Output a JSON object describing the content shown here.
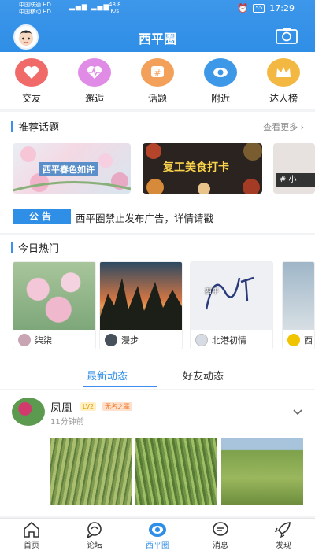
{
  "status": {
    "carrier1": "中国联通",
    "carrier2": "中国移动",
    "hd": "HD",
    "net_speed": "48.8",
    "net_unit": "K/s",
    "battery": "55",
    "time": "17:29"
  },
  "header": {
    "title": "西平圈"
  },
  "quick_icons": [
    {
      "label": "交友",
      "icon": "heart-icon",
      "color": "#f06a6a"
    },
    {
      "label": "邂逅",
      "icon": "heartbeat-icon",
      "color": "#e08be6"
    },
    {
      "label": "话题",
      "icon": "hashtag-icon",
      "color": "#f3a05a"
    },
    {
      "label": "附近",
      "icon": "location-eye-icon",
      "color": "#3d98e8"
    },
    {
      "label": "达人榜",
      "icon": "crown-icon",
      "color": "#f3b841"
    }
  ],
  "topics": {
    "title": "推荐话题",
    "more": "查看更多",
    "cards": [
      {
        "text": "西平春色如许"
      },
      {
        "text": "复工美食打卡"
      },
      {
        "text": "# 小"
      }
    ]
  },
  "notice": {
    "tag": "公告",
    "text": "西平圈禁止发布广告，详情请戳"
  },
  "hot": {
    "title": "今日热门",
    "items": [
      {
        "user": "柒柒"
      },
      {
        "user": "漫步"
      },
      {
        "user": "北港初情"
      },
      {
        "user": "西"
      }
    ],
    "overlay_text": "西平"
  },
  "tabs": {
    "latest": "最新动态",
    "friends": "好友动态"
  },
  "post": {
    "name": "凤凰",
    "level": "LV2",
    "badge": "无名之辈",
    "time": "11分钟前"
  },
  "bottom_nav": {
    "home": "首页",
    "forum": "论坛",
    "circle": "西平圈",
    "messages": "消息",
    "discover": "发现"
  }
}
